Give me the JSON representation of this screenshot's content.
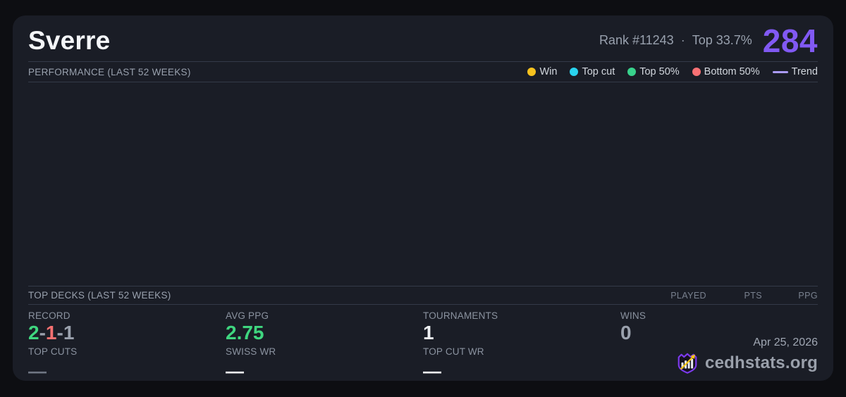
{
  "header": {
    "player_name": "Sverre",
    "rank_label": "Rank #11243",
    "separator": "·",
    "top_label": "Top 33.7%",
    "score": "284"
  },
  "performance": {
    "title": "PERFORMANCE (LAST 52 WEEKS)",
    "legend": [
      {
        "name": "win",
        "label": "Win",
        "color": "#f6c21e",
        "marker": "dot"
      },
      {
        "name": "top-cut",
        "label": "Top cut",
        "color": "#29d3ee",
        "marker": "dot"
      },
      {
        "name": "top-50",
        "label": "Top 50%",
        "color": "#38d28c",
        "marker": "dot"
      },
      {
        "name": "bottom-50",
        "label": "Bottom 50%",
        "color": "#f87174",
        "marker": "dot"
      },
      {
        "name": "trend",
        "label": "Trend",
        "color": "#ab9bf8",
        "marker": "line"
      }
    ],
    "chart_points": []
  },
  "top_decks": {
    "title": "TOP DECKS (LAST 52 WEEKS)",
    "columns": [
      "PLAYED",
      "PTS",
      "PPG"
    ],
    "rows": []
  },
  "stats": {
    "record": {
      "label": "RECORD",
      "wins": "2",
      "losses": "1",
      "draws": "1",
      "separator": "-"
    },
    "avg_ppg": {
      "label": "AVG PPG",
      "value": "2.75"
    },
    "tournaments": {
      "label": "TOURNAMENTS",
      "value": "1"
    },
    "wins": {
      "label": "WINS",
      "value": "0"
    },
    "top_cuts": {
      "label": "TOP CUTS",
      "value": "—"
    },
    "swiss_wr": {
      "label": "SWISS WR",
      "value": "—"
    },
    "top_cut_wr": {
      "label": "TOP CUT WR",
      "value": "—"
    }
  },
  "footer": {
    "date": "Apr 25, 2026",
    "brand": "cedhstats.org"
  },
  "colors": {
    "page_bg": "#0d0e12",
    "card_bg": "#1a1d26",
    "divider": "#343a48",
    "accent_purple": "#8159f3",
    "win_yellow": "#f6c21e",
    "topcut_cyan": "#29d3ee",
    "top50_green": "#38d28c",
    "bottom50_red": "#f87174",
    "trend_purple": "#ab9bf8",
    "value_green": "#3fd67f",
    "value_red": "#f87171",
    "muted_grey": "#9aa1ad"
  }
}
